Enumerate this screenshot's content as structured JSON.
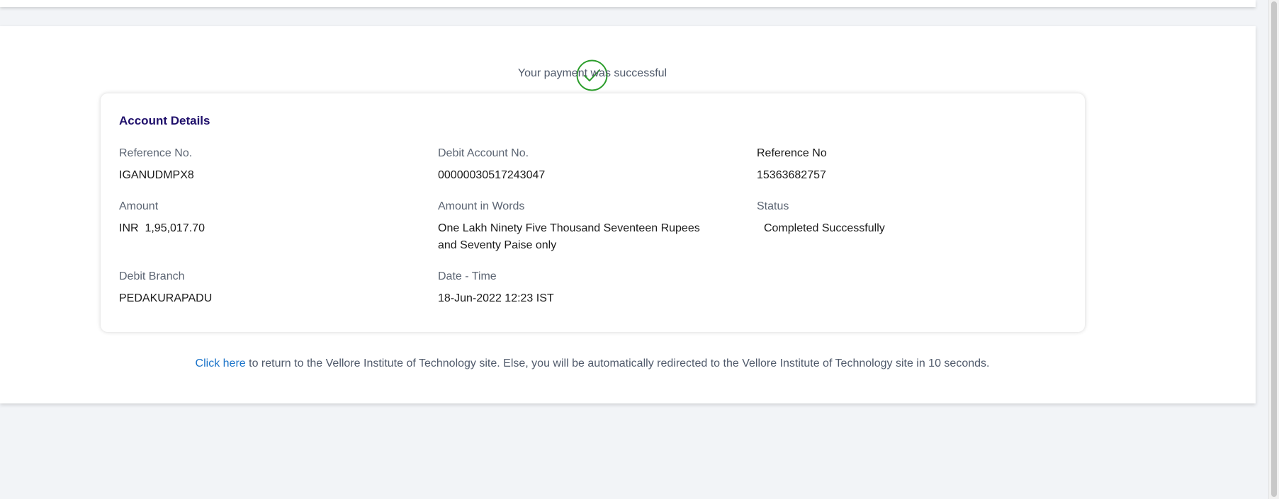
{
  "status": {
    "icon": "check-circle-icon",
    "message": "Your payment was successful",
    "color": "#2a9d2a"
  },
  "card": {
    "title": "Account Details",
    "fields": [
      {
        "label": "Reference No.",
        "value": "IGANUDMPX8"
      },
      {
        "label": "Debit Account No.",
        "value": "00000030517243047"
      },
      {
        "label": "Reference No",
        "value": "15363682757"
      },
      {
        "label": "Amount",
        "value": "INR  1,95,017.70"
      },
      {
        "label": "Amount in Words",
        "value": "One Lakh Ninety Five Thousand Seventeen Rupees and Seventy Paise only"
      },
      {
        "label": "Status",
        "value": "Completed Successfully"
      },
      {
        "label": "Debit Branch",
        "value": "PEDAKURAPADU"
      },
      {
        "label": "Date - Time",
        "value": "18-Jun-2022 12:23 IST"
      }
    ]
  },
  "redirect": {
    "link_text": "Click here",
    "message": " to return to the Vellore Institute of Technology site. Else, you will be automatically redirected to the Vellore Institute of Technology site in 10 seconds."
  },
  "colors": {
    "title": "#1f0f6b",
    "link": "#1a73c9",
    "background": "#f2f4f7"
  }
}
